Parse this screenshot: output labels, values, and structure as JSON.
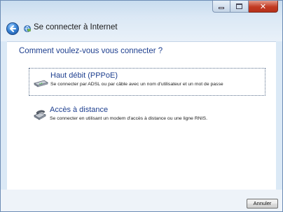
{
  "window": {
    "title": "Se connecter à Internet",
    "controls": {
      "minimize_icon": "minimize-icon",
      "maximize_icon": "maximize-icon",
      "close_icon": "close-icon"
    },
    "back_icon": "back-arrow-icon",
    "title_icon": "network-icon"
  },
  "main": {
    "question": "Comment voulez-vous vous connecter ?",
    "options": [
      {
        "title": "Haut débit (PPPoE)",
        "description": "Se connecter par ADSL ou par câble avec un nom d'utilisateur et un mot de passe",
        "icon": "broadband-modem-icon",
        "selected": true
      },
      {
        "title": "Accès à distance",
        "description": "Se connecter en utilisant un modem d'accès à distance ou une ligne RNIS.",
        "icon": "dialup-phone-icon",
        "selected": false
      }
    ]
  },
  "footer": {
    "cancel_label": "Annuler"
  },
  "colors": {
    "link_blue": "#1e3f8f",
    "close_red": "#c23a22",
    "frame": "#dbe9f6"
  }
}
